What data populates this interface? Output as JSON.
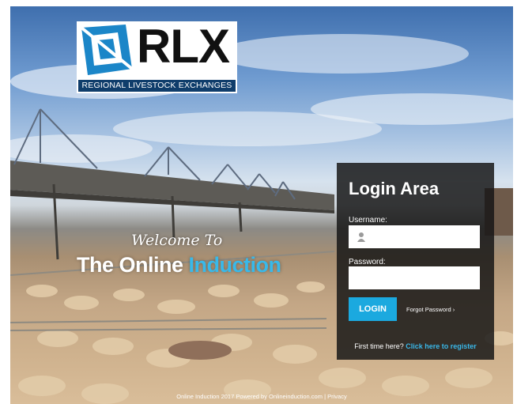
{
  "logo": {
    "wordmark": "RLX",
    "tagline": "REGIONAL LIVESTOCK EXCHANGES"
  },
  "hero": {
    "welcome": "Welcome To",
    "headline_part1": "The Online",
    "headline_part2": "Induction"
  },
  "login": {
    "title": "Login Area",
    "username_label": "Username:",
    "username_value": "",
    "password_label": "Password:",
    "password_value": "",
    "login_button": "LOGIN",
    "forgot_password": "Forgot Password",
    "forgot_arrow": "›",
    "first_time": "First time here?",
    "register_link": "Click here to register"
  },
  "footer": {
    "copyright": "Online Induction 2017 Powered by Onlineinduction.com",
    "separator": "|",
    "privacy": "Privacy"
  },
  "colors": {
    "accent": "#1ba9df",
    "logo_navy": "#0f3d6b",
    "panel_bg": "#161616"
  },
  "icons": {
    "user_icon": "user-icon",
    "logo_mark": "rlx-cube-icon"
  }
}
